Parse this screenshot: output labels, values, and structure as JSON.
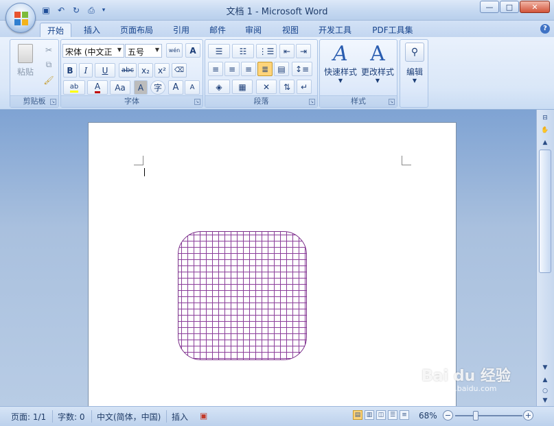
{
  "window": {
    "title": "文档 1 - Microsoft Word",
    "minimize": "—",
    "maximize": "□",
    "close": "✕"
  },
  "quick_access": {
    "icons": [
      "save-icon",
      "undo-icon",
      "redo-icon",
      "print-preview-icon",
      "customize-icon"
    ]
  },
  "tabs": [
    "开始",
    "插入",
    "页面布局",
    "引用",
    "邮件",
    "审阅",
    "视图",
    "开发工具",
    "PDF工具集"
  ],
  "active_tab": "开始",
  "help": "?",
  "ribbon": {
    "clipboard": {
      "label": "剪贴板",
      "paste": "粘贴"
    },
    "font": {
      "label": "字体",
      "font_name": "宋体 (中文正",
      "font_size": "五号",
      "phonetic": "wén",
      "bold": "B",
      "italic": "I",
      "underline": "U",
      "strike": "abc",
      "subscript": "x₂",
      "superscript": "x²",
      "font_color": "A",
      "change_case": "Aa",
      "char_shading": "A",
      "enclose": "字",
      "grow": "A",
      "shrink": "A"
    },
    "paragraph": {
      "label": "段落"
    },
    "styles": {
      "label": "样式",
      "quick_styles": "快速样式",
      "change_styles": "更改样式"
    },
    "editing": {
      "label": "编辑"
    }
  },
  "document": {},
  "status": {
    "page": "页面: 1/1",
    "words": "字数: 0",
    "language": "中文(简体，中国)",
    "mode": "插入",
    "zoom": "68%"
  },
  "watermark": {
    "text": "Bai du 经验",
    "sub": "jingyan.baidu.com"
  },
  "colors": {
    "accent": "#15428b",
    "shape_grid": "#8a3d99"
  }
}
